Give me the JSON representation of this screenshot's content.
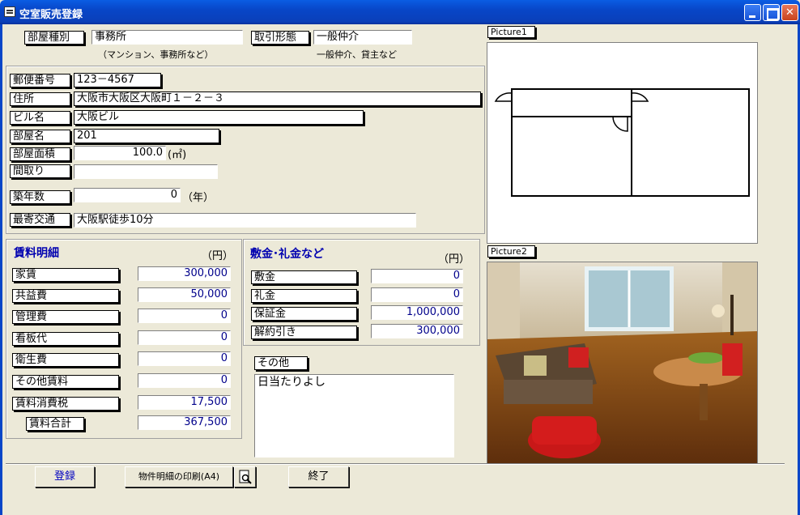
{
  "window": {
    "title": "空室販売登録"
  },
  "header": {
    "room_type_label": "部屋種別",
    "room_type_value": "事務所",
    "room_type_note": "（マンション、事務所など）",
    "deal_type_label": "取引形態",
    "deal_type_value": "一般仲介",
    "deal_type_note": "一般仲介、貸主など"
  },
  "property": {
    "postal_label": "郵便番号",
    "postal_value": "123－4567",
    "address_label": "住所",
    "address_value": "大阪市大阪区大阪町１－２－３",
    "building_label": "ビル名",
    "building_value": "大阪ビル",
    "room_label": "部屋名",
    "room_value": "201",
    "area_label": "部屋面積",
    "area_value": "100.0",
    "area_unit": "(㎡)",
    "layout_label": "間取り",
    "layout_value": "",
    "age_label": "築年数",
    "age_value": "0",
    "age_unit": "（年）",
    "transit_label": "最寄交通",
    "transit_value": "大阪駅徒歩10分"
  },
  "rent": {
    "title": "賃料明細",
    "unit": "（円）",
    "items": [
      {
        "label": "家賃",
        "value": "300,000"
      },
      {
        "label": "共益費",
        "value": "50,000"
      },
      {
        "label": "管理費",
        "value": "0"
      },
      {
        "label": "看板代",
        "value": "0"
      },
      {
        "label": "衛生費",
        "value": "0"
      },
      {
        "label": "その他賃料",
        "value": "0"
      },
      {
        "label": "賃料消費税",
        "value": "17,500"
      }
    ],
    "total_label": "賃料合計",
    "total_value": "367,500"
  },
  "deposit": {
    "title": "敷金･礼金など",
    "unit": "（円）",
    "items": [
      {
        "label": "敷金",
        "value": "0"
      },
      {
        "label": "礼金",
        "value": "0"
      },
      {
        "label": "保証金",
        "value": "1,000,000"
      },
      {
        "label": "解約引き",
        "value": "300,000"
      }
    ]
  },
  "other": {
    "label": "その他",
    "value": "日当たりよし"
  },
  "pictures": {
    "picture1_label": "Picture1",
    "picture2_label": "Picture2"
  },
  "buttons": {
    "register": "登録",
    "print": "物件明細の印刷(A4)",
    "exit": "終了"
  },
  "colors": {
    "titlebar": "#0a5de3",
    "accent_text": "#0000b0",
    "number_text": "#00008b",
    "form_bg": "#ece9d8"
  }
}
